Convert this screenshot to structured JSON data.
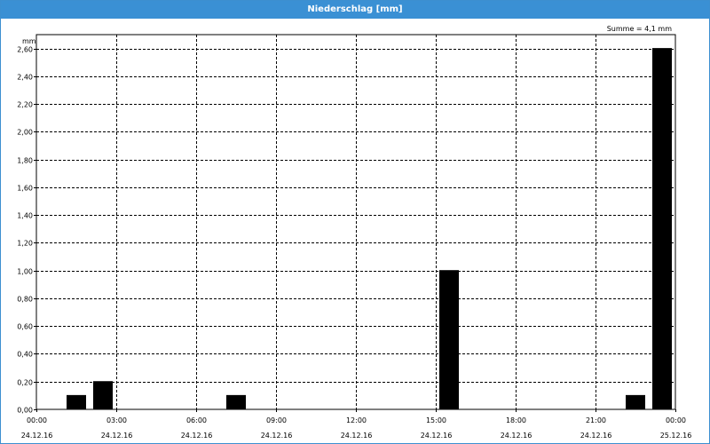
{
  "window": {
    "title": "Niederschlag [mm]"
  },
  "chart_data": {
    "type": "bar",
    "title": "Niederschlag [mm]",
    "ylabel": "mm",
    "annotation": "Summe = 4,1 mm",
    "ylim": [
      0,
      2.7
    ],
    "y_ticks": [
      0,
      0.2,
      0.4,
      0.6,
      0.8,
      1.0,
      1.2,
      1.4,
      1.6,
      1.8,
      2.0,
      2.2,
      2.4,
      2.6
    ],
    "y_tick_labels": [
      "0,00",
      "0,20",
      "0,40",
      "0,60",
      "0,80",
      "1,00",
      "1,20",
      "1,40",
      "1,60",
      "1,80",
      "2,00",
      "2,20",
      "2,40",
      "2,60"
    ],
    "x_range_hours": [
      0,
      24
    ],
    "x_ticks": [
      {
        "hour": 0,
        "time": "00:00",
        "date": "24.12.16"
      },
      {
        "hour": 3,
        "time": "03:00",
        "date": "24.12.16"
      },
      {
        "hour": 6,
        "time": "06:00",
        "date": "24.12.16"
      },
      {
        "hour": 9,
        "time": "09:00",
        "date": "24.12.16"
      },
      {
        "hour": 12,
        "time": "12:00",
        "date": "24.12.16"
      },
      {
        "hour": 15,
        "time": "15:00",
        "date": "24.12.16"
      },
      {
        "hour": 18,
        "time": "18:00",
        "date": "24.12.16"
      },
      {
        "hour": 21,
        "time": "21:00",
        "date": "24.12.16"
      },
      {
        "hour": 24,
        "time": "00:00",
        "date": "25.12.16"
      }
    ],
    "bars": [
      {
        "hour": 1.5,
        "value": 0.1
      },
      {
        "hour": 2.5,
        "value": 0.2
      },
      {
        "hour": 7.5,
        "value": 0.1
      },
      {
        "hour": 15.5,
        "value": 1.0
      },
      {
        "hour": 22.5,
        "value": 0.1
      },
      {
        "hour": 23.5,
        "value": 2.6
      }
    ],
    "bar_color": "#000000",
    "grid": true
  }
}
